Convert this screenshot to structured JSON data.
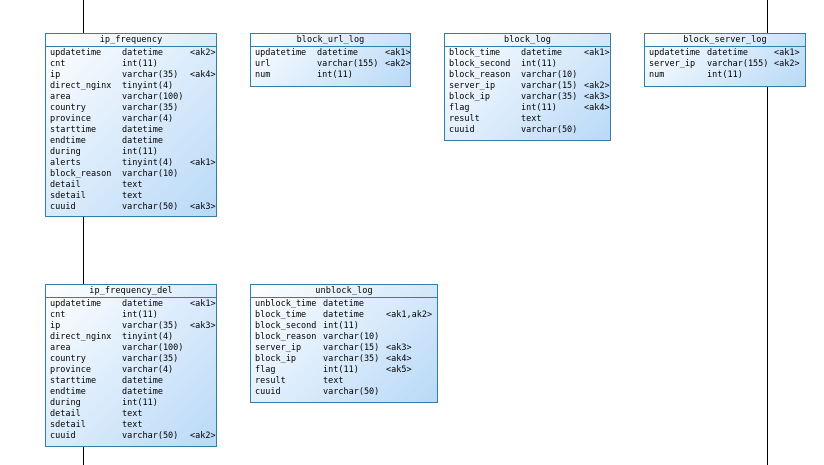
{
  "diagram": {
    "entities": [
      {
        "id": "ip-frequency",
        "title": "ip_frequency",
        "columns": [
          {
            "name": "updatetime",
            "type": "datetime",
            "key": "<ak2>"
          },
          {
            "name": "cnt",
            "type": "int(11)",
            "key": ""
          },
          {
            "name": "ip",
            "type": "varchar(35)",
            "key": "<ak4>"
          },
          {
            "name": "direct_nginx",
            "type": "tinyint(4)",
            "key": ""
          },
          {
            "name": "area",
            "type": "varchar(100)",
            "key": ""
          },
          {
            "name": "country",
            "type": "varchar(35)",
            "key": ""
          },
          {
            "name": "province",
            "type": "varchar(4)",
            "key": ""
          },
          {
            "name": "starttime",
            "type": "datetime",
            "key": ""
          },
          {
            "name": "endtime",
            "type": "datetime",
            "key": ""
          },
          {
            "name": "during",
            "type": "int(11)",
            "key": ""
          },
          {
            "name": "alerts",
            "type": "tinyint(4)",
            "key": "<ak1>"
          },
          {
            "name": "block_reason",
            "type": "varchar(10)",
            "key": ""
          },
          {
            "name": "detail",
            "type": "text",
            "key": ""
          },
          {
            "name": "sdetail",
            "type": "text",
            "key": ""
          },
          {
            "name": "cuuid",
            "type": "varchar(50)",
            "key": "<ak3>"
          }
        ]
      },
      {
        "id": "block-url-log",
        "title": "block_url_log",
        "columns": [
          {
            "name": "updatetime",
            "type": "datetime",
            "key": "<ak1>"
          },
          {
            "name": "url",
            "type": "varchar(155)",
            "key": "<ak2>"
          },
          {
            "name": "num",
            "type": "int(11)",
            "key": ""
          }
        ]
      },
      {
        "id": "block-log",
        "title": "block_log",
        "columns": [
          {
            "name": "block_time",
            "type": "datetime",
            "key": "<ak1>"
          },
          {
            "name": "block_second",
            "type": "int(11)",
            "key": ""
          },
          {
            "name": "block_reason",
            "type": "varchar(10)",
            "key": ""
          },
          {
            "name": "server_ip",
            "type": "varchar(15)",
            "key": "<ak2>"
          },
          {
            "name": "block_ip",
            "type": "varchar(35)",
            "key": "<ak3>"
          },
          {
            "name": "flag",
            "type": "int(11)",
            "key": "<ak4>"
          },
          {
            "name": "result",
            "type": "text",
            "key": ""
          },
          {
            "name": "cuuid",
            "type": "varchar(50)",
            "key": ""
          }
        ]
      },
      {
        "id": "block-server-log",
        "title": "block_server_log",
        "columns": [
          {
            "name": "updatetime",
            "type": "datetime",
            "key": "<ak1>"
          },
          {
            "name": "server_ip",
            "type": "varchar(155)",
            "key": "<ak2>"
          },
          {
            "name": "num",
            "type": "int(11)",
            "key": ""
          }
        ]
      },
      {
        "id": "ip-frequency-del",
        "title": "ip_frequency_del",
        "columns": [
          {
            "name": "updatetime",
            "type": "datetime",
            "key": "<ak1>"
          },
          {
            "name": "cnt",
            "type": "int(11)",
            "key": ""
          },
          {
            "name": "ip",
            "type": "varchar(35)",
            "key": "<ak3>"
          },
          {
            "name": "direct_nginx",
            "type": "tinyint(4)",
            "key": ""
          },
          {
            "name": "area",
            "type": "varchar(100)",
            "key": ""
          },
          {
            "name": "country",
            "type": "varchar(35)",
            "key": ""
          },
          {
            "name": "province",
            "type": "varchar(4)",
            "key": ""
          },
          {
            "name": "starttime",
            "type": "datetime",
            "key": ""
          },
          {
            "name": "endtime",
            "type": "datetime",
            "key": ""
          },
          {
            "name": "during",
            "type": "int(11)",
            "key": ""
          },
          {
            "name": "detail",
            "type": "text",
            "key": ""
          },
          {
            "name": "sdetail",
            "type": "text",
            "key": ""
          },
          {
            "name": "cuuid",
            "type": "varchar(50)",
            "key": "<ak2>"
          }
        ]
      },
      {
        "id": "unblock-log",
        "title": "unblock_log",
        "columns": [
          {
            "name": "unblock_time",
            "type": "datetime",
            "key": ""
          },
          {
            "name": "block_time",
            "type": "datetime",
            "key": "<ak1,ak2>"
          },
          {
            "name": "block_second",
            "type": "int(11)",
            "key": ""
          },
          {
            "name": "block_reason",
            "type": "varchar(10)",
            "key": ""
          },
          {
            "name": "server_ip",
            "type": "varchar(15)",
            "key": "<ak3>"
          },
          {
            "name": "block_ip",
            "type": "varchar(35)",
            "key": "<ak4>"
          },
          {
            "name": "flag",
            "type": "int(11)",
            "key": "<ak5>"
          },
          {
            "name": "result",
            "type": "text",
            "key": ""
          },
          {
            "name": "cuuid",
            "type": "varchar(50)",
            "key": ""
          }
        ]
      }
    ],
    "colors": {
      "border": "#2f7fa8",
      "gradient_end": "#b9d9f7"
    }
  }
}
